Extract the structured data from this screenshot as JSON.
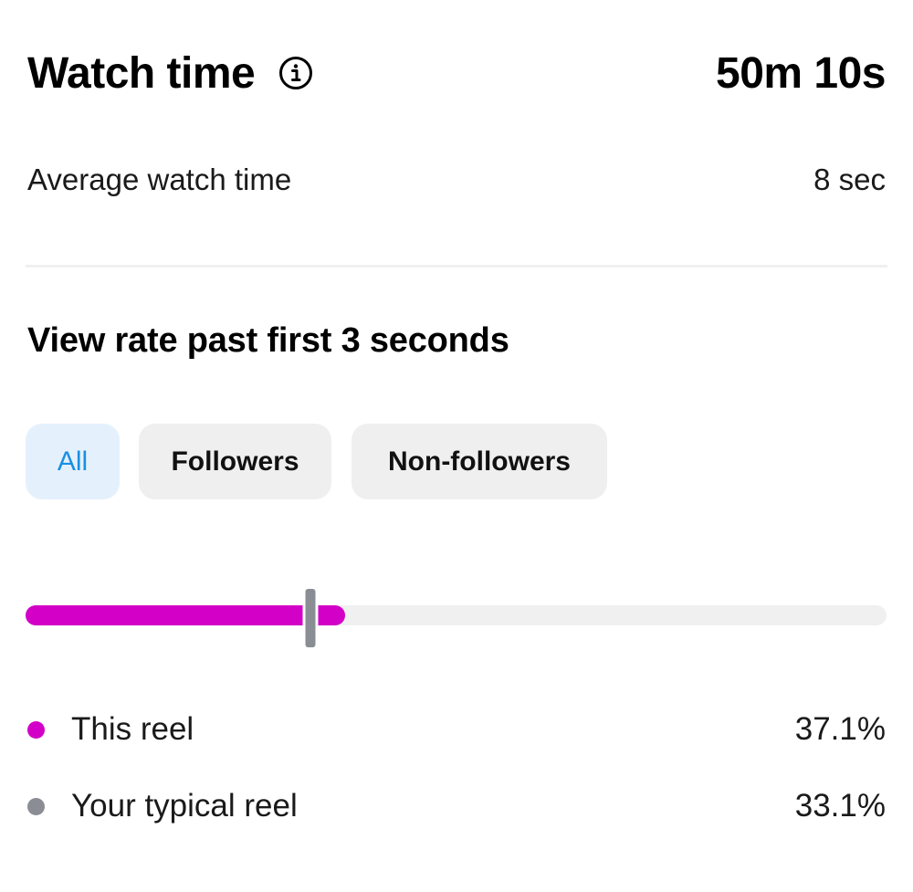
{
  "watch_time": {
    "title": "Watch time",
    "value": "50m 10s",
    "info_icon": "info-icon"
  },
  "average_watch_time": {
    "label": "Average watch time",
    "value": "8 sec"
  },
  "view_rate": {
    "title": "View rate past first 3 seconds",
    "filters": [
      {
        "label": "All",
        "selected": true
      },
      {
        "label": "Followers",
        "selected": false
      },
      {
        "label": "Non-followers",
        "selected": false
      }
    ],
    "this_reel": {
      "label": "This reel",
      "value": "37.1%",
      "rate": 0.371,
      "color": "#d300c7"
    },
    "typical_reel": {
      "label": "Your typical reel",
      "value": "33.1%",
      "rate": 0.331,
      "color": "#8a8d93"
    }
  },
  "colors": {
    "accent_selected_text": "#1a8fe3",
    "accent_selected_bg": "#e4f1fd",
    "chip_bg": "#efefef",
    "track_bg": "#f0f0f0"
  }
}
